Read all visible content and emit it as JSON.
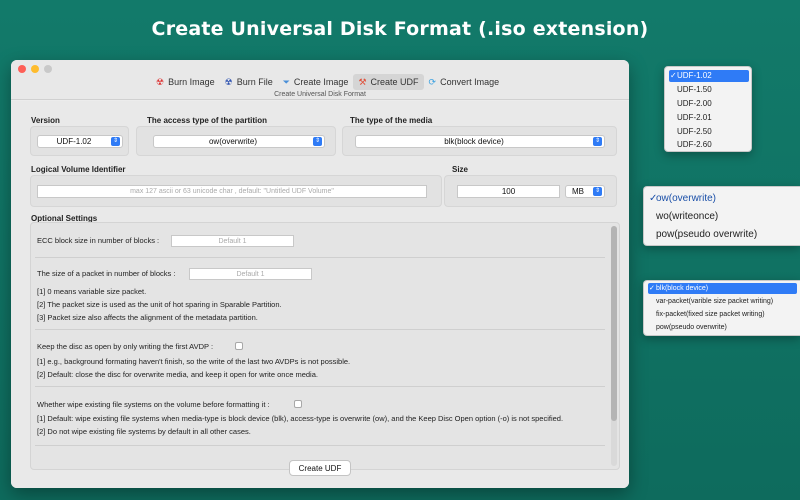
{
  "headline": "Create Universal Disk Format (.iso extension)",
  "toolbar": {
    "tabs": [
      {
        "label": "Burn Image",
        "icon": "radiation-icon"
      },
      {
        "label": "Burn File",
        "icon": "burn-file-icon"
      },
      {
        "label": "Create Image",
        "icon": "funnel-icon"
      },
      {
        "label": "Create UDF",
        "icon": "hammer-icon"
      },
      {
        "label": "Convert Image",
        "icon": "refresh-icon"
      }
    ],
    "active_tab": "Create UDF",
    "subtitle": "Create Universal Disk Format"
  },
  "form": {
    "version_label": "Version",
    "version_value": "UDF-1.02",
    "access_label": "The access type of the partition",
    "access_value": "ow(overwrite)",
    "media_label": "The type of the media",
    "media_value": "blk(block device)",
    "lvi_label": "Logical Volume Identifier",
    "lvi_placeholder": "max 127 ascii or 63 unicode char , default: \"Untitled UDF Volume\"",
    "size_label": "Size",
    "size_value": "100",
    "size_unit": "MB"
  },
  "optional": {
    "title": "Optional Settings",
    "ecc_label": "ECC block size in number of blocks :",
    "ecc_placeholder": "Default 1",
    "packet_label": "The size of a packet in number of blocks :",
    "packet_placeholder": "Default 1",
    "packet_notes": [
      "[1] 0 means variable size packet.",
      "[2] The packet size is used as the unit of hot sparing in Sparable Partition.",
      "[3] Packet size also affects the alignment of the metadata partition."
    ],
    "keepopen_label": "Keep the disc as open by only writing the first AVDP :",
    "keepopen_notes": [
      "[1]  e.g., background formating haven't finish, so the write of the last two AVDPs is not possible.",
      "[2] Default: close the disc for overwrite media, and keep it open for write once media."
    ],
    "wipe_label": "Whether wipe existing file systems on the volume before formatting it :",
    "wipe_notes": [
      "[1] Default: wipe existing file systems when media-type is block device (blk), access-type is overwrite (ow), and the Keep Disc Open option (-o) is not specified.",
      "[2] Do not wipe existing file systems by default in all other cases."
    ]
  },
  "action": {
    "create_label": "Create UDF"
  },
  "menus": {
    "version_options": [
      "UDF-1.02",
      "UDF-1.50",
      "UDF-2.00",
      "UDF-2.01",
      "UDF-2.50",
      "UDF-2.60"
    ],
    "access_options": [
      "ow(overwrite)",
      "wo(writeonce)",
      "pow(pseudo overwrite)"
    ],
    "media_options": [
      "blk(block device)",
      "var-packet(varible size packet writing)",
      "fix-packet(fixed size packet writing)",
      "pow(pseudo overwrite)"
    ],
    "check_glyph": "✓"
  },
  "colors": {
    "background": "#127a6a",
    "accent": "#2f7bf6"
  }
}
